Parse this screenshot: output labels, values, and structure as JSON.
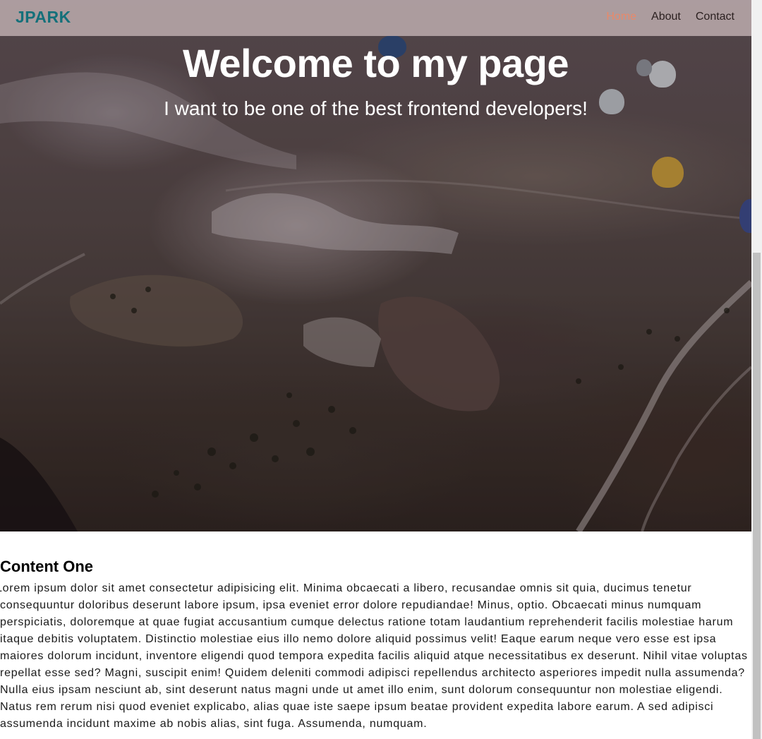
{
  "navbar": {
    "logo": "JPARK",
    "links": [
      {
        "label": "Home",
        "active": true
      },
      {
        "label": "About",
        "active": false
      },
      {
        "label": "Contact",
        "active": false
      }
    ]
  },
  "hero": {
    "title": "Welcome to my page",
    "subtitle": "I want to be one of the best frontend developers!"
  },
  "content": {
    "heading": "Content One",
    "body": "Lorem ipsum dolor sit amet consectetur adipisicing elit. Minima obcaecati a libero, recusandae omnis sit quia, ducimus tenetur consequuntur doloribus deserunt labore ipsum, ipsa eveniet error dolore repudiandae! Minus, optio. Obcaecati minus numquam perspiciatis, doloremque at quae fugiat accusantium cumque delectus ratione totam laudantium reprehenderit facilis molestiae harum itaque debitis voluptatem. Distinctio molestiae eius illo nemo dolore aliquid possimus velit! Eaque earum neque vero esse est ipsa maiores dolorum incidunt, inventore eligendi quod tempora expedita facilis aliquid atque necessitatibus ex deserunt. Nihil vitae voluptas repellat esse sed? Magni, suscipit enim! Quidem deleniti commodi adipisci repellendus architecto asperiores impedit nulla assumenda? Nulla eius ipsam nesciunt ab, sint deserunt natus magni unde ut amet illo enim, sunt dolorum consequuntur non molestiae eligendi. Natus rem rerum nisi quod eveniet explicabo, alias quae iste saepe ipsum beatae provident expedita labore earum. A sed adipisci assumenda incidunt maxime ab nobis alias, sint fuga. Assumenda, numquam."
  },
  "colors": {
    "logo": "#14707a",
    "active_link": "#e8896a",
    "navbar_bg": "#b4a4a6"
  }
}
